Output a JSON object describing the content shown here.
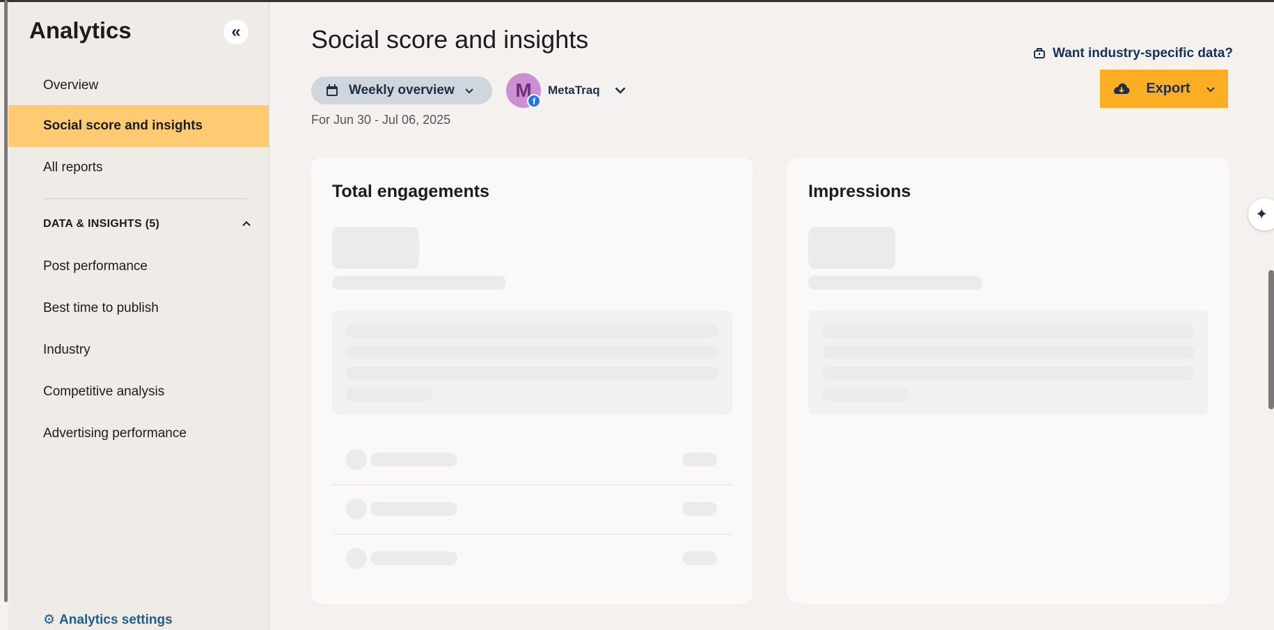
{
  "sidebar": {
    "title": "Analytics",
    "nav": [
      {
        "label": "Overview"
      },
      {
        "label": "Social score and insights",
        "active": true
      },
      {
        "label": "All reports"
      }
    ],
    "section": {
      "label": "DATA & INSIGHTS (5)",
      "expanded": true
    },
    "sub_items": [
      {
        "label": "Post performance"
      },
      {
        "label": "Best time to publish"
      },
      {
        "label": "Industry"
      },
      {
        "label": "Competitive analysis"
      },
      {
        "label": "Advertising performance"
      }
    ],
    "settings_label": "Analytics settings"
  },
  "header": {
    "title": "Social score and insights",
    "period_label": "Weekly overview",
    "account": {
      "initial": "M",
      "name": "MetaTraq",
      "network": "facebook"
    },
    "date_range": "For Jun 30 - Jul 06, 2025",
    "industry_link": "Want industry-specific data?",
    "export_label": "Export"
  },
  "cards": [
    {
      "title": "Total engagements",
      "loading": true
    },
    {
      "title": "Impressions",
      "loading": true
    }
  ],
  "colors": {
    "accent": "#fbad23",
    "active_nav": "#fecb73",
    "link": "#1f5c8e",
    "pill_bg": "#cfd6de"
  }
}
